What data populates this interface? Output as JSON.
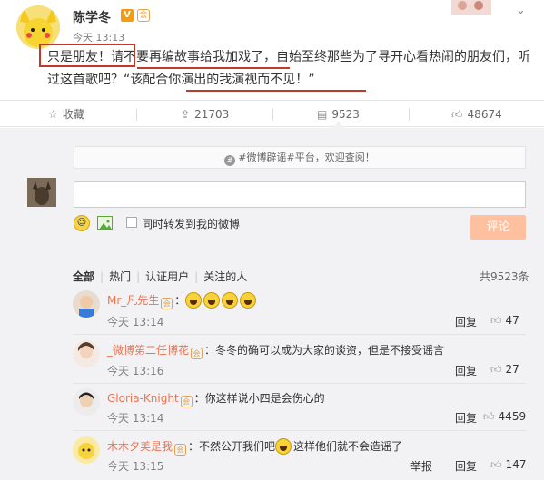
{
  "post": {
    "user_name": "陈学冬",
    "verified_badge": "V",
    "vip_badge": "会",
    "time": "今天 13:13",
    "text_1": "只是朋友！",
    "text_2": "请不要再编故事给我加戏了",
    "text_3": "，自始至终那些为了寻开心看热闹的朋友们，听过这首歌吧？",
    "text_4": "“该配合你演出的我演视而不见！",
    "text_5": "”"
  },
  "actions": {
    "favorite": "收藏",
    "repost_count": "21703",
    "comment_count": "9523",
    "like_count": "48674",
    "favorite_icon": "star-icon",
    "repost_icon": "repost-icon",
    "comment_icon": "comment-icon",
    "like_icon": "thumbs-up-icon"
  },
  "notice": "#微博辟谣#平台，欢迎查阅！",
  "compose": {
    "input_value": "",
    "forward_label": "同时转发到我的微博",
    "submit_label": "评论"
  },
  "filters": {
    "all": "全部",
    "hot": "热门",
    "verified": "认证用户",
    "following": "关注的人",
    "total": "共9523条"
  },
  "comments": [
    {
      "user": "Mr_凡先生",
      "text": "：",
      "emoji_count": 4,
      "time": "今天 13:14",
      "reply": "回复",
      "likes": "47"
    },
    {
      "user": "_微博第二任博花",
      "text": "：冬冬的确可以成为大家的谈资，但是不接受谣言",
      "time": "今天 13:16",
      "reply": "回复",
      "likes": "27"
    },
    {
      "user": "Gloria-Knight",
      "text": "：你这样说小四是会伤心的",
      "time": "今天 13:14",
      "reply": "回复",
      "likes": "4459"
    },
    {
      "user": "木木夕美是我",
      "text_a": "：不然公开我们吧",
      "text_b": "这样他们就不会造谣了",
      "time": "今天 13:15",
      "report": "举报",
      "reply": "回复",
      "likes": "147"
    }
  ],
  "colors": {
    "accent": "#eb7350",
    "highlight_red": "#c0392b",
    "submit_bg": "#ffc09f",
    "comments_bg": "#f2f2f5"
  }
}
